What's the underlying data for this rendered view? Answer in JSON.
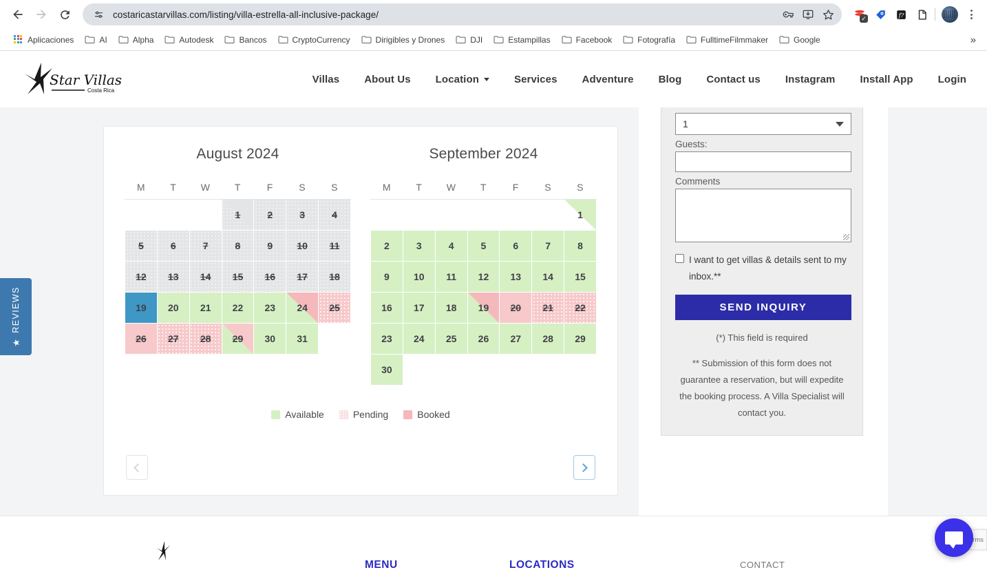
{
  "browser": {
    "url": "costaricastarvillas.com/listing/villa-estrella-all-inclusive-package/",
    "back_label": "Back",
    "forward_label": "Forward",
    "reload_label": "Reload",
    "site_info_label": "View site information",
    "omnibox_icons": [
      "password-key-icon",
      "install-app-icon",
      "bookmark-star-icon"
    ],
    "extension_icons": [
      "extension-red-icon",
      "extension-blue-tag-icon",
      "extension-fx-icon",
      "extension-clipboard-icon"
    ],
    "profile_label": "Profile",
    "menu_label": "Customize and control Chrome",
    "bookmarks": [
      {
        "label": "Aplicaciones",
        "icon": "apps-grid-icon"
      },
      {
        "label": "AI",
        "icon": "folder-icon"
      },
      {
        "label": "Alpha",
        "icon": "folder-icon"
      },
      {
        "label": "Autodesk",
        "icon": "folder-icon"
      },
      {
        "label": "Bancos",
        "icon": "folder-icon"
      },
      {
        "label": "CryptoCurrency",
        "icon": "folder-icon"
      },
      {
        "label": "Dirigibles y Drones",
        "icon": "folder-icon"
      },
      {
        "label": "DJI",
        "icon": "folder-icon"
      },
      {
        "label": "Estampillas",
        "icon": "folder-icon"
      },
      {
        "label": "Facebook",
        "icon": "folder-icon"
      },
      {
        "label": "Fotografía",
        "icon": "folder-icon"
      },
      {
        "label": "FulltimeFilmmaker",
        "icon": "folder-icon"
      },
      {
        "label": "Google",
        "icon": "folder-icon"
      }
    ],
    "bookmarks_overflow": "»"
  },
  "site": {
    "logo": {
      "name": "Star Villas",
      "subtitle": "Costa Rica"
    },
    "nav": [
      {
        "label": "Villas",
        "has_dropdown": false
      },
      {
        "label": "About Us",
        "has_dropdown": false
      },
      {
        "label": "Location",
        "has_dropdown": true
      },
      {
        "label": "Services",
        "has_dropdown": false
      },
      {
        "label": "Adventure",
        "has_dropdown": false
      },
      {
        "label": "Blog",
        "has_dropdown": false
      },
      {
        "label": "Contact us",
        "has_dropdown": false
      },
      {
        "label": "Instagram",
        "has_dropdown": false
      },
      {
        "label": "Install App",
        "has_dropdown": false
      },
      {
        "label": "Login",
        "has_dropdown": false
      }
    ]
  },
  "reviews_tab": {
    "label": "REVIEWS",
    "star": "★"
  },
  "calendar": {
    "weekday_headers": [
      "M",
      "T",
      "W",
      "T",
      "F",
      "S",
      "S"
    ],
    "legend": [
      {
        "label": "Available",
        "color": "#d6f0c4"
      },
      {
        "label": "Pending",
        "color": "#f9dfe0"
      },
      {
        "label": "Booked",
        "color": "#f5b8bb"
      }
    ],
    "prev_label": "Previous months",
    "next_label": "Next months",
    "months": [
      {
        "name": "August",
        "year": "2024",
        "weeks": [
          [
            {
              "day": "",
              "state": "empty"
            },
            {
              "day": "",
              "state": "empty"
            },
            {
              "day": "",
              "state": "empty"
            },
            {
              "day": "1",
              "state": "past",
              "half": "tr",
              "tri": "#e4e5e7"
            },
            {
              "day": "2",
              "state": "past"
            },
            {
              "day": "3",
              "state": "past"
            },
            {
              "day": "4",
              "state": "past"
            }
          ],
          [
            {
              "day": "5",
              "state": "past"
            },
            {
              "day": "6",
              "state": "past"
            },
            {
              "day": "7",
              "state": "past"
            },
            {
              "day": "8",
              "state": "past"
            },
            {
              "day": "9",
              "state": "past"
            },
            {
              "day": "10",
              "state": "past"
            },
            {
              "day": "11",
              "state": "past"
            }
          ],
          [
            {
              "day": "12",
              "state": "past"
            },
            {
              "day": "13",
              "state": "past"
            },
            {
              "day": "14",
              "state": "past"
            },
            {
              "day": "15",
              "state": "past"
            },
            {
              "day": "16",
              "state": "past"
            },
            {
              "day": "17",
              "state": "past"
            },
            {
              "day": "18",
              "state": "past"
            }
          ],
          [
            {
              "day": "19",
              "state": "selected"
            },
            {
              "day": "20",
              "state": "avail"
            },
            {
              "day": "21",
              "state": "avail"
            },
            {
              "day": "22",
              "state": "avail"
            },
            {
              "day": "23",
              "state": "avail"
            },
            {
              "day": "24",
              "state": "avail",
              "half": "tr",
              "tri": "#f5b8bb"
            },
            {
              "day": "25",
              "state": "pending"
            }
          ],
          [
            {
              "day": "26",
              "state": "booked"
            },
            {
              "day": "27",
              "state": "pending"
            },
            {
              "day": "28",
              "state": "pending"
            },
            {
              "day": "29",
              "state": "booked",
              "half": "bl",
              "tri": "#d6f0c4"
            },
            {
              "day": "30",
              "state": "avail"
            },
            {
              "day": "31",
              "state": "avail"
            },
            {
              "day": "",
              "state": "empty"
            }
          ]
        ]
      },
      {
        "name": "September",
        "year": "2024",
        "weeks": [
          [
            {
              "day": "",
              "state": "empty"
            },
            {
              "day": "",
              "state": "empty"
            },
            {
              "day": "",
              "state": "empty"
            },
            {
              "day": "",
              "state": "empty"
            },
            {
              "day": "",
              "state": "empty"
            },
            {
              "day": "",
              "state": "empty"
            },
            {
              "day": "1",
              "state": "empty",
              "half": "tr",
              "tri": "#d6f0c4"
            }
          ],
          [
            {
              "day": "2",
              "state": "avail"
            },
            {
              "day": "3",
              "state": "avail"
            },
            {
              "day": "4",
              "state": "avail"
            },
            {
              "day": "5",
              "state": "avail"
            },
            {
              "day": "6",
              "state": "avail"
            },
            {
              "day": "7",
              "state": "avail"
            },
            {
              "day": "8",
              "state": "avail"
            }
          ],
          [
            {
              "day": "9",
              "state": "avail"
            },
            {
              "day": "10",
              "state": "avail"
            },
            {
              "day": "11",
              "state": "avail"
            },
            {
              "day": "12",
              "state": "avail"
            },
            {
              "day": "13",
              "state": "avail"
            },
            {
              "day": "14",
              "state": "avail"
            },
            {
              "day": "15",
              "state": "avail"
            }
          ],
          [
            {
              "day": "16",
              "state": "avail"
            },
            {
              "day": "17",
              "state": "avail"
            },
            {
              "day": "18",
              "state": "avail"
            },
            {
              "day": "19",
              "state": "avail",
              "half": "tr",
              "tri": "#f5b8bb"
            },
            {
              "day": "20",
              "state": "booked"
            },
            {
              "day": "21",
              "state": "pending"
            },
            {
              "day": "22",
              "state": "pending"
            }
          ],
          [
            {
              "day": "23",
              "state": "avail"
            },
            {
              "day": "24",
              "state": "avail"
            },
            {
              "day": "25",
              "state": "avail"
            },
            {
              "day": "26",
              "state": "avail"
            },
            {
              "day": "27",
              "state": "avail"
            },
            {
              "day": "28",
              "state": "avail"
            },
            {
              "day": "29",
              "state": "avail"
            }
          ],
          [
            {
              "day": "30",
              "state": "avail"
            },
            {
              "day": "",
              "state": "empty"
            },
            {
              "day": "",
              "state": "empty"
            },
            {
              "day": "",
              "state": "empty"
            },
            {
              "day": "",
              "state": "empty"
            },
            {
              "day": "",
              "state": "empty"
            },
            {
              "day": "",
              "state": "empty"
            }
          ]
        ]
      }
    ]
  },
  "inquiry_form": {
    "nights_value": "1",
    "guests_label": "Guests:",
    "guests_value": "",
    "comments_label": "Comments",
    "comments_value": "",
    "optin_text": "I want to get villas & details sent to my inbox.**",
    "optin_checked": false,
    "submit_label": "SEND INQUIRY",
    "required_note": "(*) This field is required",
    "submit_note": "** Submission of this form does not guarantee a reservation, but will expedite the booking process. A Villa Specialist will contact you."
  },
  "footer": {
    "menu_heading": "MENU",
    "locations_heading": "LOCATIONS",
    "contact_heading": "CONTACT"
  },
  "widgets": {
    "recaptcha_text": "- Terms",
    "chat_label": "Open chat"
  }
}
